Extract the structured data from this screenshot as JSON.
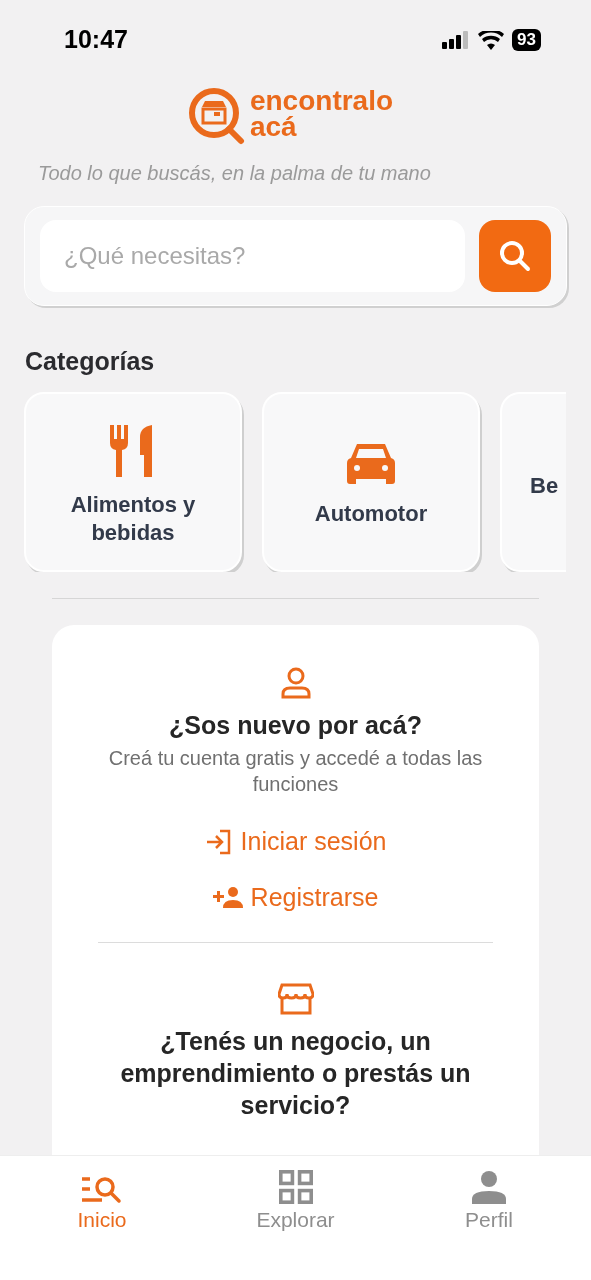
{
  "status_bar": {
    "time": "10:47",
    "battery": "93"
  },
  "logo": {
    "line1": "encontralo",
    "line2": "acá"
  },
  "tagline": "Todo lo que buscás, en la palma de tu mano",
  "search": {
    "placeholder": "¿Qué necesitas?"
  },
  "categories": {
    "title": "Categorías",
    "items": [
      {
        "kind": "food",
        "label": "Alimentos y bebidas"
      },
      {
        "kind": "car",
        "label": "Automotor"
      },
      {
        "kind": "none",
        "label": "Be"
      }
    ]
  },
  "welcome_card": {
    "title": "¿Sos nuevo por acá?",
    "subtitle": "Creá tu cuenta gratis y accedé a todas las funciones",
    "login": "Iniciar sesión",
    "register": "Registrarse",
    "business_title": "¿Tenés un negocio, un emprendimiento o prestás un servicio?"
  },
  "tab_bar": [
    {
      "kind": "home",
      "label": "Inicio",
      "selected": true
    },
    {
      "kind": "explore",
      "label": "Explorar",
      "selected": false
    },
    {
      "kind": "profile",
      "label": "Perfil",
      "selected": false
    }
  ]
}
